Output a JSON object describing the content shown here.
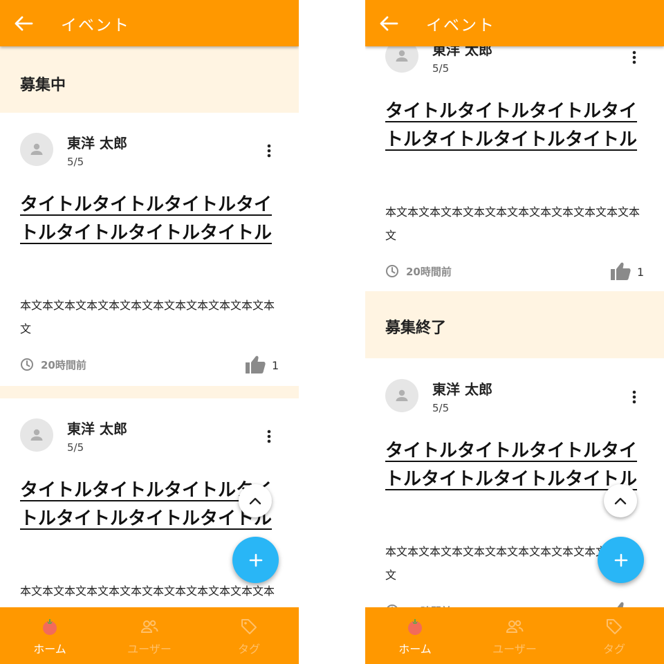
{
  "app": {
    "title": "イベント"
  },
  "sections": {
    "recruiting": "募集中",
    "closed": "募集終了"
  },
  "post": {
    "author": "東洋 太郎",
    "participants": "5/5",
    "title": "タイトルタイトルタイトルタイトルタイトルタイトルタイトル",
    "body": "本文本文本文本文本文本文本文本文本文本文本文本文",
    "time": "20時間前",
    "likes": "1"
  },
  "nav": {
    "home": "ホーム",
    "users": "ユーザー",
    "tags": "タグ"
  },
  "colors": {
    "primary": "#ff9800",
    "section_bg": "#fff4e2",
    "fab": "#29b6f6",
    "nav_inactive": "#ffc069"
  },
  "icons": [
    "back-arrow-icon",
    "person-icon",
    "more-vert-icon",
    "clock-icon",
    "thumb-up-icon",
    "chevron-up-icon",
    "plus-icon",
    "tomato-icon",
    "people-icon",
    "tag-icon"
  ]
}
